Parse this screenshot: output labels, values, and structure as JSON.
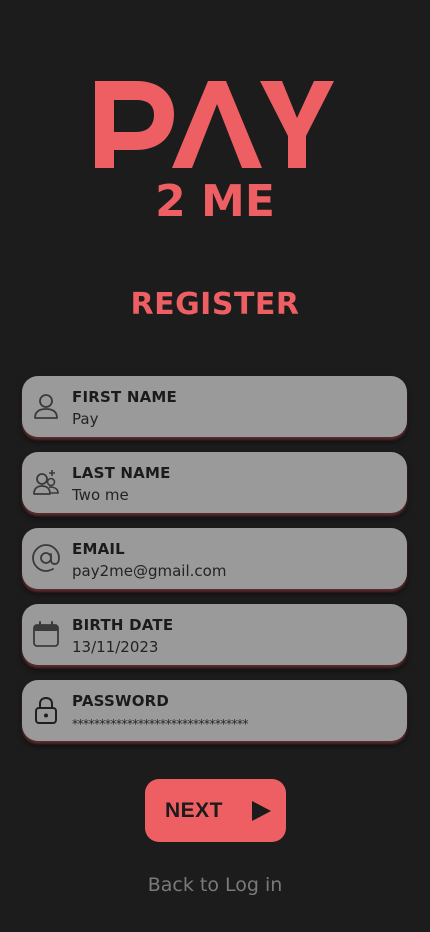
{
  "brand": {
    "logo_line1": "PAY",
    "logo_line2": "2 ME",
    "accent_color": "#ee5f63"
  },
  "page_title": "REGISTER",
  "fields": [
    {
      "label": "FIRST NAME",
      "value": "Pay",
      "icon": "user-icon"
    },
    {
      "label": "LAST NAME",
      "value": "Two me",
      "icon": "add-user-icon"
    },
    {
      "label": "EMAIL",
      "value": "pay2me@gmail.com",
      "icon": "at-sign-icon"
    },
    {
      "label": "BIRTH DATE",
      "value": "13/11/2023",
      "icon": "calendar-icon"
    },
    {
      "label": "PASSWORD",
      "value": "********************************",
      "icon": "lock-icon"
    }
  ],
  "next_button": {
    "label": "NEXT",
    "icon": "play-icon"
  },
  "back_link": "Back to Log in"
}
